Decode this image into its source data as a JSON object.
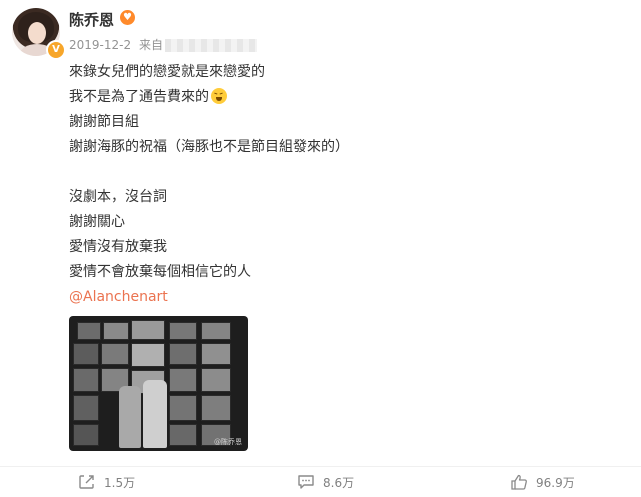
{
  "post": {
    "username": "陈乔恩",
    "date": "2019-12-2",
    "source_prefix": "来自",
    "lines": [
      "來錄女兒們的戀愛就是來戀愛的",
      "我不是為了通告費來的",
      "謝謝節目組",
      "謝謝海豚的祝福（海豚也不是節目組發來的）",
      "",
      "沒劇本，沒台詞",
      "謝謝關心",
      "愛情沒有放棄我",
      "愛情不會放棄每個相信它的人"
    ],
    "mention": "@Alanchenart",
    "icons": {
      "verified": "verified-v-icon",
      "user_badge": "heart-face-icon",
      "emoji": "laughing-emoji-icon"
    },
    "image_watermark": "@陈乔恩"
  },
  "actions": {
    "repost_count": "1.5万",
    "comment_count": "8.6万",
    "like_count": "96.9万"
  },
  "colors": {
    "mention": "#eb7350",
    "meta": "#939393",
    "badge": "#f7a62a"
  }
}
